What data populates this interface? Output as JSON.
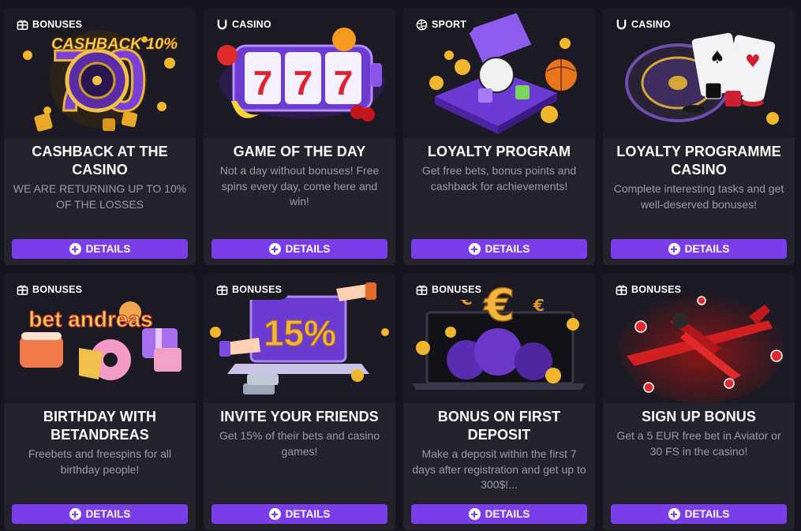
{
  "promotions": [
    {
      "badge": "BONUSES",
      "badge_icon": "gift-icon",
      "title": "CASHBACK AT THE CASINO",
      "description": "WE ARE RETURNING UP TO 10% OF THE LOSSES",
      "art_text": "CASHBACK 10%",
      "button": "DETAILS"
    },
    {
      "badge": "CASINO",
      "badge_icon": "horseshoe-icon",
      "title": "GAME OF THE DAY",
      "description": "Not a day without bonuses! Free spins every day, come here and win!",
      "art_text": "777",
      "button": "DETAILS"
    },
    {
      "badge": "SPORT",
      "badge_icon": "volleyball-icon",
      "title": "LOYALTY PROGRAM",
      "description": "Get free bets, bonus points and cashback for achievements!",
      "art_text": "",
      "button": "DETAILS"
    },
    {
      "badge": "CASINO",
      "badge_icon": "horseshoe-icon",
      "title": "LOYALTY PROGRAMME CASINO",
      "description": "Complete interesting tasks and get well-deserved bonuses!",
      "art_text": "",
      "button": "DETAILS"
    },
    {
      "badge": "BONUSES",
      "badge_icon": "gift-icon",
      "title": "BIRTHDAY WITH BETANDREAS",
      "description": "Freebets and freespins for all birthday people!",
      "art_text": "bet andreas",
      "button": "DETAILS"
    },
    {
      "badge": "BONUSES",
      "badge_icon": "gift-icon",
      "title": "INVITE YOUR FRIENDS",
      "description": "Get 15% of their bets and casino games!",
      "art_text": "15%",
      "button": "DETAILS"
    },
    {
      "badge": "BONUSES",
      "badge_icon": "gift-icon",
      "title": "BONUS ON FIRST DEPOSIT",
      "description": "Make a deposit within the first 7 days after registration and get up to 300$!...",
      "art_text": "€",
      "button": "DETAILS"
    },
    {
      "badge": "BONUSES",
      "badge_icon": "gift-icon",
      "title": "SIGN UP BONUS",
      "description": "Get a 5 EUR free bet in Aviator or 30 FS in the casino!",
      "art_text": "",
      "button": "DETAILS"
    }
  ],
  "colors": {
    "background": "#16151d",
    "card": "#24232d",
    "button": "#7b3dea",
    "description": "#9b99a6"
  }
}
